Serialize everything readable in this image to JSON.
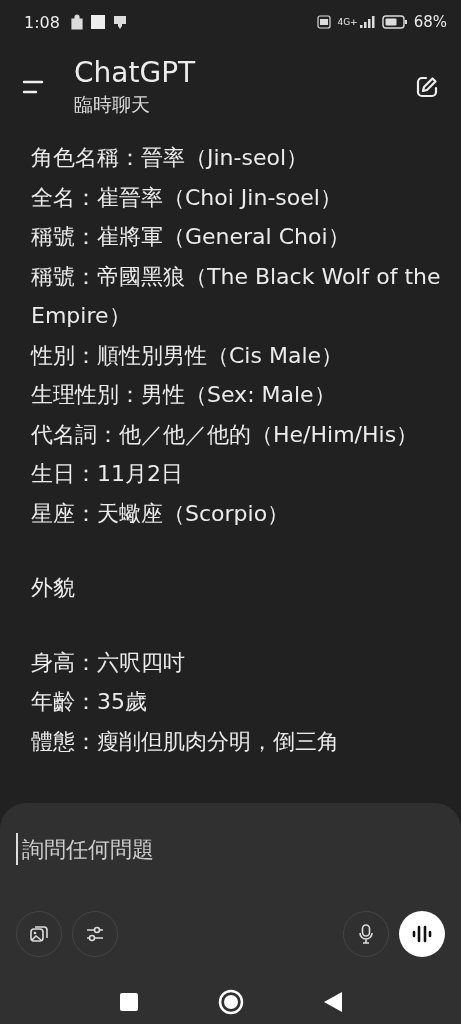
{
  "status_bar": {
    "time": "1:08",
    "network": "4G+",
    "battery": "68%"
  },
  "header": {
    "title": "ChatGPT",
    "subtitle": "臨時聊天"
  },
  "paragraphs": [
    [
      "角色名稱：晉率（Jin-seol）",
      "全名：崔晉率（Choi Jin-soel）",
      "稱號：崔將軍（General Choi）",
      "稱號：帝國黑狼（The Black Wolf of the Empire）",
      "性別：順性別男性（Cis Male）",
      "生理性別：男性（Sex: Male）",
      "代名詞：他／他／他的（He/Him/His）",
      "生日：11月2日",
      "星座：天蠍座（Scorpio）"
    ],
    [
      "外貌"
    ],
    [
      "身高：六呎四吋",
      "年齡：35歲",
      "體態：瘦削但肌肉分明，倒三角"
    ]
  ],
  "composer": {
    "placeholder": "詢問任何問題"
  }
}
